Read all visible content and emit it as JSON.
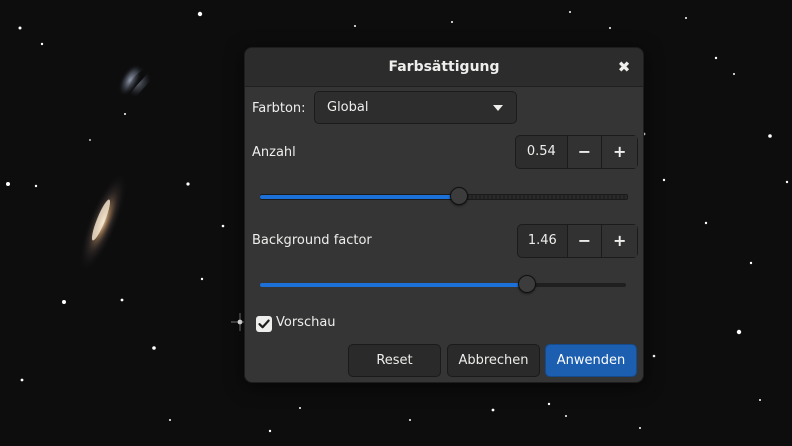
{
  "dialog": {
    "title": "Farbsättigung",
    "close_icon": "close-icon"
  },
  "hue": {
    "label": "Farbton:",
    "selected": "Global"
  },
  "amount": {
    "label": "Anzahl",
    "value": "0.54",
    "slider_fraction": 0.54,
    "minus": "−",
    "plus": "+"
  },
  "background": {
    "label": "Background factor",
    "value": "1.46",
    "slider_fraction": 0.73,
    "minus": "−",
    "plus": "+"
  },
  "preview": {
    "label": "Vorschau",
    "checked": true
  },
  "buttons": {
    "reset": "Reset",
    "cancel": "Abbrechen",
    "apply": "Anwenden"
  },
  "colors": {
    "accent": "#1c71d8",
    "dialog_bg": "#353535",
    "apply_bg": "#1c5fb0"
  }
}
